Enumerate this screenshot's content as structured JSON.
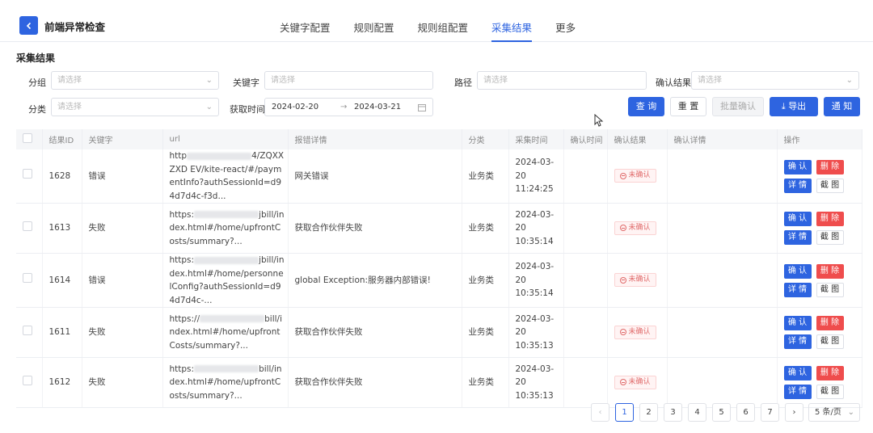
{
  "header": {
    "title": "前端异常检查",
    "tabs": [
      {
        "label": "关键字配置"
      },
      {
        "label": "规则配置"
      },
      {
        "label": "规则组配置"
      },
      {
        "label": "采集结果"
      },
      {
        "label": "更多"
      }
    ],
    "active_tab": "采集结果"
  },
  "section_title": "采集结果",
  "filters": {
    "group_label": "分组",
    "group_placeholder": "请选择",
    "keyword_label": "关键字",
    "keyword_placeholder": "请选择",
    "path_label": "路径",
    "path_placeholder": "请选择",
    "confirm_label": "确认结果",
    "confirm_placeholder": "请选择",
    "category_label": "分类",
    "category_placeholder": "请选择",
    "time_label": "获取时间",
    "date_start": "2024-02-20",
    "date_sep": "→",
    "date_end": "2024-03-21"
  },
  "buttons": {
    "query": "查 询",
    "reset": "重 置",
    "batch_confirm": "批量确认",
    "export": "导出",
    "notify": "通 知"
  },
  "table": {
    "columns": [
      "结果ID",
      "关键字",
      "url",
      "报错详情",
      "分类",
      "采集时间",
      "确认时间",
      "确认结果",
      "确认详情",
      "操作"
    ],
    "rows": [
      {
        "id": "1628",
        "keyword": "错误",
        "url_a": "http",
        "url_b": "4/ZQXXZXD EV/kite-react/#/paymentInfo?authSessionId=d94d7d4c-f3d...",
        "detail": "网关错误",
        "category": "业务类",
        "date": "2024-03-20",
        "time": "11:24:25",
        "status": "未确认"
      },
      {
        "id": "1613",
        "keyword": "失败",
        "url_a": "https:",
        "url_b": "jbill/index.html#/home/upfrontCosts/summary?...",
        "detail": "获取合作伙伴失败",
        "category": "业务类",
        "date": "2024-03-20",
        "time": "10:35:14",
        "status": "未确认"
      },
      {
        "id": "1614",
        "keyword": "错误",
        "url_a": "https:",
        "url_b": "jbill/index.html#/home/personnelConfig?authSessionId=d94d7d4c-...",
        "detail": "global Exception:服务器内部错误!",
        "category": "业务类",
        "date": "2024-03-20",
        "time": "10:35:14",
        "status": "未确认"
      },
      {
        "id": "1611",
        "keyword": "失败",
        "url_a": "https://",
        "url_b": "bill/index.html#/home/upfrontCosts/summary?...",
        "detail": "获取合作伙伴失败",
        "category": "业务类",
        "date": "2024-03-20",
        "time": "10:35:13",
        "status": "未确认"
      },
      {
        "id": "1612",
        "keyword": "失败",
        "url_a": "https:",
        "url_b": "bill/index.html#/home/upfrontCosts/summary?...",
        "detail": "获取合作伙伴失败",
        "category": "业务类",
        "date": "2024-03-20",
        "time": "10:35:13",
        "status": "未确认"
      }
    ],
    "actions": {
      "confirm": "确 认",
      "delete": "删 除",
      "detail": "详 情",
      "screenshot": "截 图"
    }
  },
  "pagination": {
    "prev": "‹",
    "pages": [
      "1",
      "2",
      "3",
      "4",
      "5",
      "6",
      "7"
    ],
    "current": "1",
    "next": "›",
    "page_size": "5 条/页"
  },
  "colors": {
    "primary": "#2e64e0",
    "danger": "#ef4d4d"
  }
}
